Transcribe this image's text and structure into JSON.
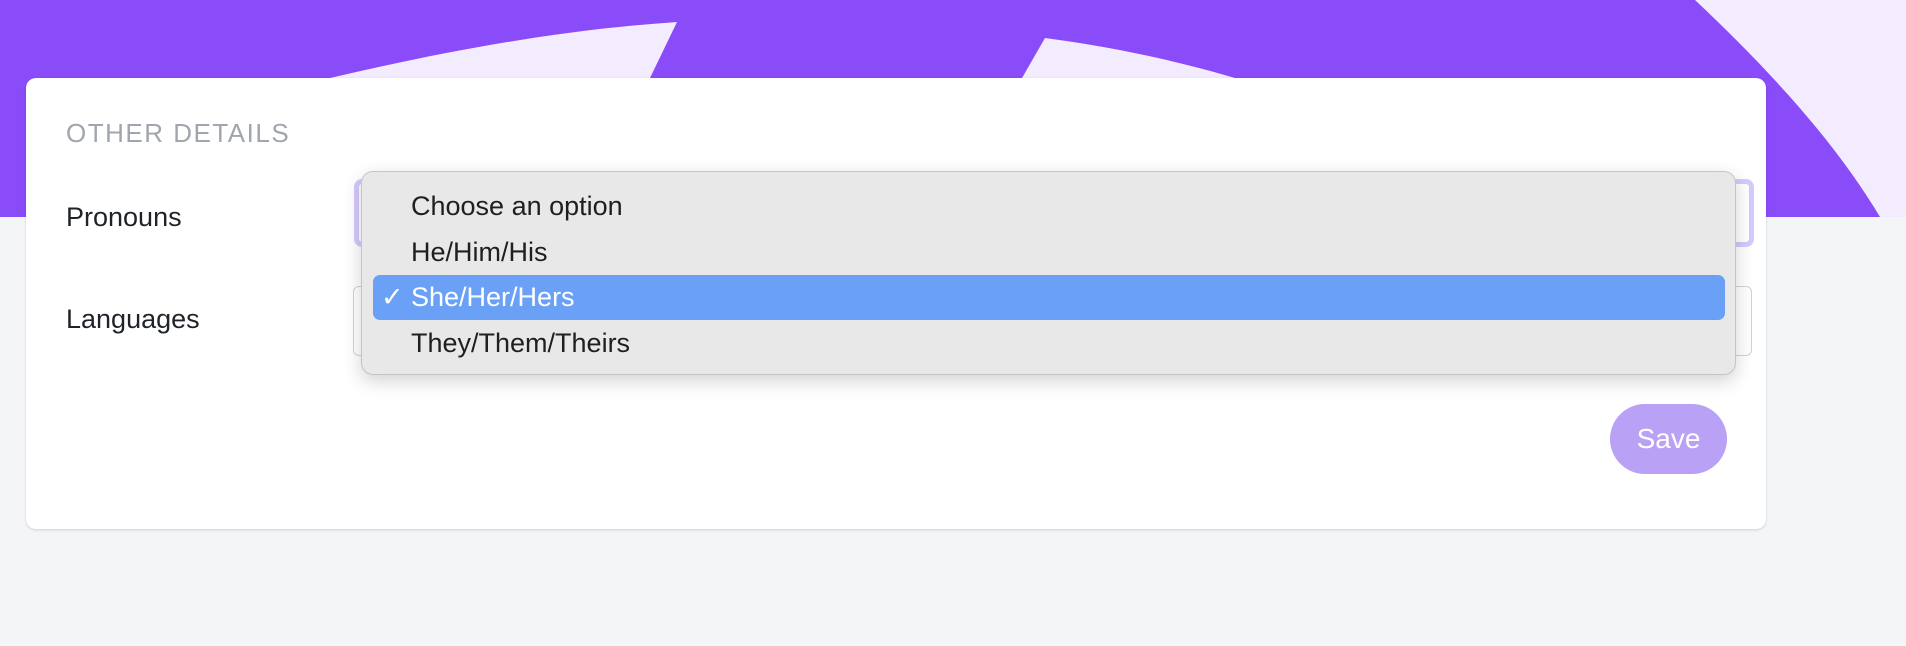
{
  "section": {
    "title": "OTHER DETAILS"
  },
  "fields": {
    "pronouns_label": "Pronouns",
    "languages_label": "Languages",
    "languages_value": ""
  },
  "pronouns_dropdown": {
    "selected_index": 2,
    "options": [
      {
        "label": "Choose an option",
        "checked": ""
      },
      {
        "label": "He/Him/His",
        "checked": ""
      },
      {
        "label": "She/Her/Hers",
        "checked": "✓"
      },
      {
        "label": "They/Them/Theirs",
        "checked": ""
      }
    ]
  },
  "actions": {
    "save_label": "Save"
  },
  "icons": {
    "select_chevron": "chevron-down-icon",
    "checkmark": "checkmark-icon"
  },
  "colors": {
    "banner_purple": "#8a4bf9",
    "banner_light": "#f3ebfe",
    "selected_option": "#6aa1f7",
    "save_button": "#b9a1f5",
    "focus_ring": "#d6c9fb"
  }
}
